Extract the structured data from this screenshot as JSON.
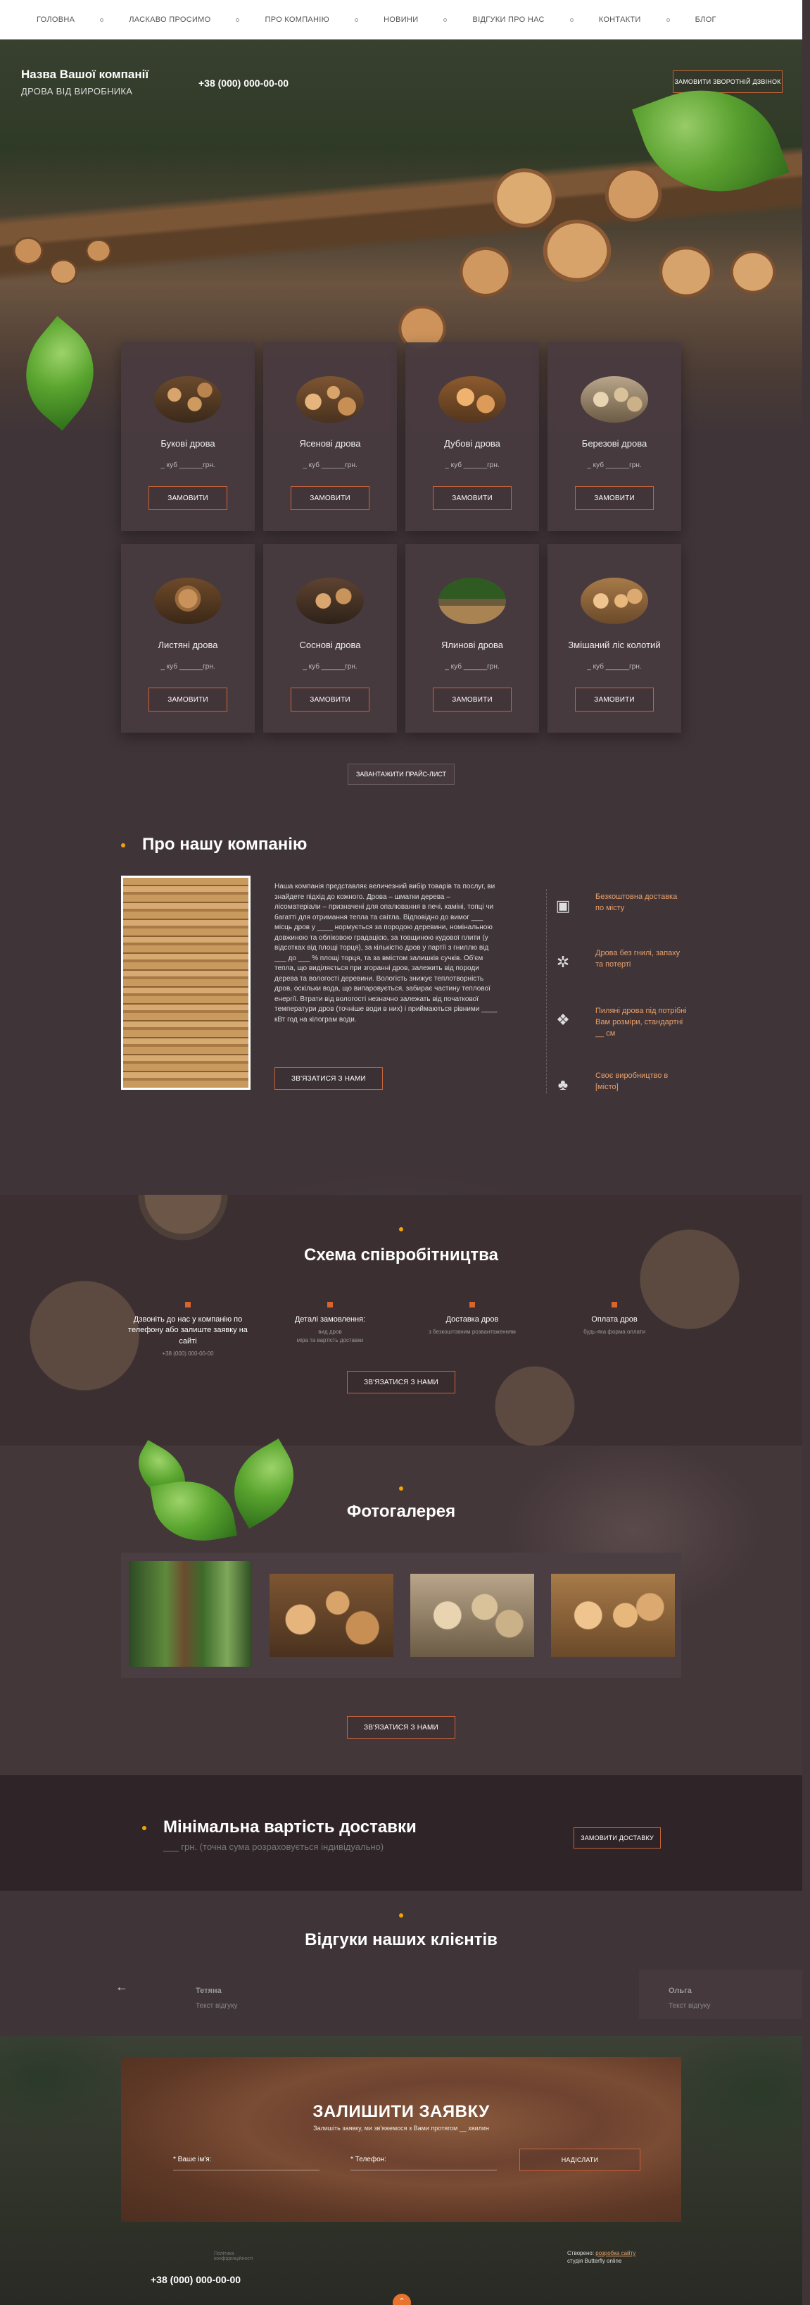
{
  "nav": [
    "Головна",
    "Ласкаво просимо",
    "Про компанію",
    "Новини",
    "Відгуки про нас",
    "Контакти",
    "Блог"
  ],
  "hero": {
    "company_name": "Назва Вашої компанії",
    "company_sub": "ДРОВА ВІД ВИРОБНИКА",
    "phone": "+38 (000) 000-00-00",
    "callback_label": "Замовити зворотній дзвінок"
  },
  "products": [
    {
      "name": "Букові дрова",
      "price": "_ куб ______грн.",
      "order": "Замовити"
    },
    {
      "name": "Ясенові дрова",
      "price": "_ куб ______грн.",
      "order": "Замовити"
    },
    {
      "name": "Дубові дрова",
      "price": "_ куб ______грн.",
      "order": "Замовити"
    },
    {
      "name": "Березові дрова",
      "price": "_ куб ______грн.",
      "order": "Замовити"
    },
    {
      "name": "Листяні дрова",
      "price": "_ куб ______грн.",
      "order": "Замовити"
    },
    {
      "name": "Соснові дрова",
      "price": "_ куб ______грн.",
      "order": "Замовити"
    },
    {
      "name": "Ялинові дрова",
      "price": "_ куб ______грн.",
      "order": "Замовити"
    },
    {
      "name": "Змішаний ліс колотий",
      "price": "_ куб ______грн.",
      "order": "Замовити"
    }
  ],
  "pricelist_label": "Завантажити прайс-лист",
  "about": {
    "title": "Про нашу компанію",
    "text": "Наша компанія представляє величезний вибір товарів та послуг, ви знайдете підхід до кожного. Дрова – шматки дерева – лісоматеріали – призначені для опалювання в печі, каміні, топці чи багатті для отримання тепла та світла. Відповідно до вимог ___ місць дров у ____ нормується за породою деревини, номінальною довжиною та обліковою градацією, за товщиною кудової плити (у відсотках від площі торця), за кількістю дров у партії з гниллю від ___ до ___ % площі торця, та за вмістом залишків сучків. Об'єм тепла, що виділяється при згоранні дров, залежить від породи дерева та вологості деревини. Вологість знижує теплотворність дров, оскільки вода, що випаровується, забирає частину теплової енергії. Втрати від вологості незначно залежать від початкової температури дров (точніше води в них) і приймаються рівними ____ кВт год на кілограм води.",
    "contact_label": "Зв'язатися з нами",
    "features": [
      "Безкоштовна доставка по місту",
      "Дрова без гнилі, запаху та потерті",
      "Пиляні дрова під потрібні Вам розміри, стандартні __ см",
      "Своє виробництво в [місто]"
    ]
  },
  "cooperation": {
    "title": "Схема співробітництва",
    "steps": [
      {
        "title": "Дзвоніть до нас у компанію по телефону або залиште заявку на сайті",
        "desc": "+38 (000) 000-00-00"
      },
      {
        "title": "Деталі замовлення:",
        "desc": "вид дров\nміра та вартість доставки"
      },
      {
        "title": "Доставка дров",
        "desc": "з безкоштовним розвантаженням"
      },
      {
        "title": "Оплата дров",
        "desc": "будь-яка форма оплати"
      }
    ],
    "contact_label": "Зв'язатися з нами"
  },
  "gallery": {
    "title": "Фотогалерея",
    "contact_label": "Зв'язатися з нами"
  },
  "delivery": {
    "title": "Мінімальна вартість доставки",
    "sub": "___ грн. (точна сума розраховується індивідуально)",
    "order_label": "Замовити доставку"
  },
  "reviews": {
    "title": "Відгуки наших клієнтів",
    "items": [
      {
        "name": "Тетяна",
        "text": "Текст відгуку"
      },
      {
        "name": "Ольга",
        "text": "Текст відгуку"
      }
    ]
  },
  "request": {
    "title": "ЗАЛИШИТИ ЗАЯВКУ",
    "sub": "Залишіть заявку, ми зв'яжемося з Вами протягом __ хвилин",
    "name_label": "* Ваше ім'я:",
    "phone_label": "* Телефон:",
    "send_label": "Надіслати"
  },
  "footer": {
    "phone": "+38 (000) 000-00-00",
    "policy_left": "Політика\nконфіденційності",
    "created_prefix": "Створено:",
    "created_link": "розробка сайту",
    "created_by": "студія Butterfly online"
  },
  "colors": {
    "accent": "#c9643a",
    "bullet": "#f0a30a",
    "bg": "#3f3438"
  }
}
